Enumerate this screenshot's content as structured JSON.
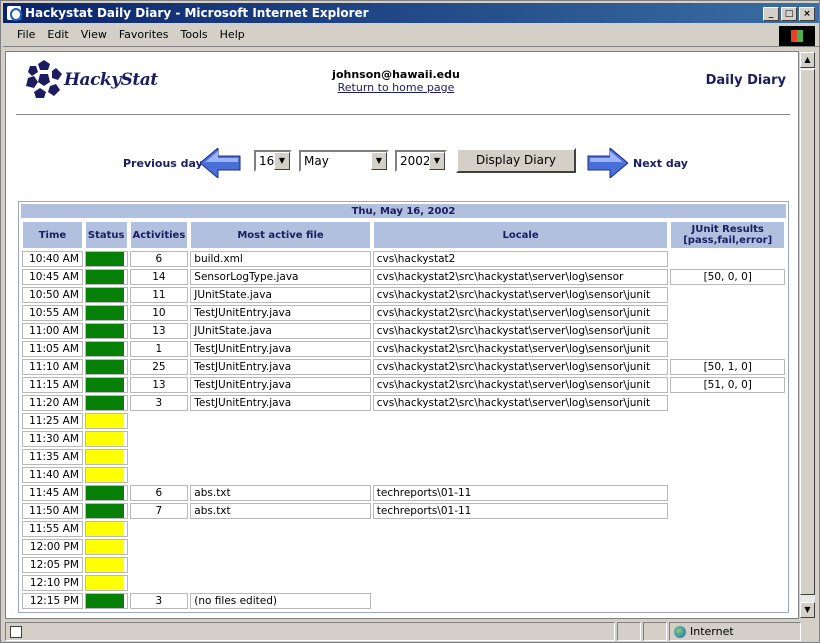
{
  "window": {
    "title": "Hackystat Daily Diary - Microsoft Internet Explorer"
  },
  "menu": [
    "File",
    "Edit",
    "View",
    "Favorites",
    "Tools",
    "Help"
  ],
  "header": {
    "logo_text": "HackyStat",
    "email": "johnson@hawaii.edu",
    "home_link": "Return to home page",
    "page_title": "Daily Diary"
  },
  "nav": {
    "prev_label": "Previous day",
    "next_label": "Next day",
    "day": "16",
    "month": "May",
    "year": "2002",
    "button": "Display Diary"
  },
  "table": {
    "date": "Thu, May 16, 2002",
    "headers": {
      "time": "Time",
      "status": "Status",
      "activities": "Activities",
      "file": "Most active file",
      "locale": "Locale",
      "junit": "JUnit Results",
      "junit_sub": "[pass,fail,error]"
    },
    "rows": [
      {
        "time": "10:40 AM",
        "status": "green",
        "activities": "6",
        "file": "build.xml",
        "locale": "cvs\\hackystat2",
        "junit": ""
      },
      {
        "time": "10:45 AM",
        "status": "green",
        "activities": "14",
        "file": "SensorLogType.java",
        "locale": "cvs\\hackystat2\\src\\hackystat\\server\\log\\sensor",
        "junit": "[50, 0, 0]"
      },
      {
        "time": "10:50 AM",
        "status": "green",
        "activities": "11",
        "file": "JUnitState.java",
        "locale": "cvs\\hackystat2\\src\\hackystat\\server\\log\\sensor\\junit",
        "junit": ""
      },
      {
        "time": "10:55 AM",
        "status": "green",
        "activities": "10",
        "file": "TestJUnitEntry.java",
        "locale": "cvs\\hackystat2\\src\\hackystat\\server\\log\\sensor\\junit",
        "junit": ""
      },
      {
        "time": "11:00 AM",
        "status": "green",
        "activities": "13",
        "file": "JUnitState.java",
        "locale": "cvs\\hackystat2\\src\\hackystat\\server\\log\\sensor\\junit",
        "junit": ""
      },
      {
        "time": "11:05 AM",
        "status": "green",
        "activities": "1",
        "file": "TestJUnitEntry.java",
        "locale": "cvs\\hackystat2\\src\\hackystat\\server\\log\\sensor\\junit",
        "junit": ""
      },
      {
        "time": "11:10 AM",
        "status": "green",
        "activities": "25",
        "file": "TestJUnitEntry.java",
        "locale": "cvs\\hackystat2\\src\\hackystat\\server\\log\\sensor\\junit",
        "junit": "[50, 1, 0]"
      },
      {
        "time": "11:15 AM",
        "status": "green",
        "activities": "13",
        "file": "TestJUnitEntry.java",
        "locale": "cvs\\hackystat2\\src\\hackystat\\server\\log\\sensor\\junit",
        "junit": "[51, 0, 0]"
      },
      {
        "time": "11:20 AM",
        "status": "green",
        "activities": "3",
        "file": "TestJUnitEntry.java",
        "locale": "cvs\\hackystat2\\src\\hackystat\\server\\log\\sensor\\junit",
        "junit": ""
      },
      {
        "time": "11:25 AM",
        "status": "yellow",
        "activities": "",
        "file": "",
        "locale": "",
        "junit": ""
      },
      {
        "time": "11:30 AM",
        "status": "yellow",
        "activities": "",
        "file": "",
        "locale": "",
        "junit": ""
      },
      {
        "time": "11:35 AM",
        "status": "yellow",
        "activities": "",
        "file": "",
        "locale": "",
        "junit": ""
      },
      {
        "time": "11:40 AM",
        "status": "yellow",
        "activities": "",
        "file": "",
        "locale": "",
        "junit": ""
      },
      {
        "time": "11:45 AM",
        "status": "green",
        "activities": "6",
        "file": "abs.txt",
        "locale": "techreports\\01-11",
        "junit": ""
      },
      {
        "time": "11:50 AM",
        "status": "green",
        "activities": "7",
        "file": "abs.txt",
        "locale": "techreports\\01-11",
        "junit": ""
      },
      {
        "time": "11:55 AM",
        "status": "yellow",
        "activities": "",
        "file": "",
        "locale": "",
        "junit": ""
      },
      {
        "time": "12:00 PM",
        "status": "yellow",
        "activities": "",
        "file": "",
        "locale": "",
        "junit": ""
      },
      {
        "time": "12:05 PM",
        "status": "yellow",
        "activities": "",
        "file": "",
        "locale": "",
        "junit": ""
      },
      {
        "time": "12:10 PM",
        "status": "yellow",
        "activities": "",
        "file": "",
        "locale": "",
        "junit": ""
      },
      {
        "time": "12:15 PM",
        "status": "green",
        "activities": "3",
        "file": "(no files edited)",
        "locale": "",
        "junit": ""
      }
    ]
  },
  "statusbar": {
    "zone": "Internet"
  },
  "colors": {
    "active": "#068006",
    "idle": "#ffff00",
    "header_bg": "#b0c0de",
    "brand": "#1c1c60"
  }
}
